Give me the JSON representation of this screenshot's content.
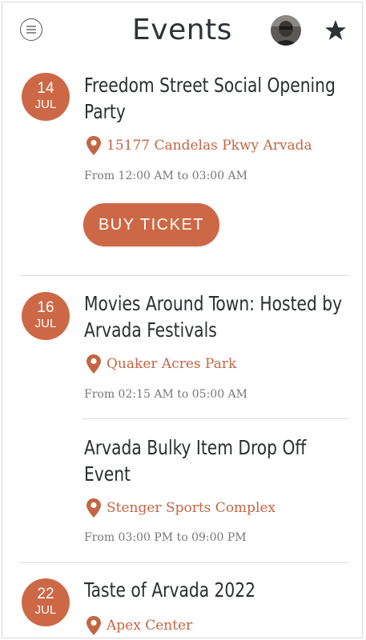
{
  "header": {
    "title": "Events",
    "menu_icon": "menu-icon",
    "favorites_icon": "star-icon"
  },
  "colors": {
    "accent": "#cd6847",
    "title_text": "#2b2f33",
    "time_text": "#777777"
  },
  "events": [
    {
      "day": "14",
      "month": "JUL",
      "title": "Freedom Street Social Opening Party",
      "location": "15177 Candelas Pkwy Arvada",
      "time": "From 12:00 AM to 03:00 AM",
      "button": "BUY TICKET"
    },
    {
      "day": "16",
      "month": "JUL",
      "title": "Movies Around Town: Hosted by Arvada Festivals",
      "location": "Quaker Acres Park",
      "time": "From 02:15 AM to 05:00 AM"
    },
    {
      "title": "Arvada Bulky Item Drop Off Event",
      "location": "Stenger Sports Complex",
      "time": "From 03:00 PM to 09:00 PM"
    },
    {
      "day": "22",
      "month": "JUL",
      "title": "Taste of Arvada 2022",
      "location": "Apex Center"
    }
  ]
}
